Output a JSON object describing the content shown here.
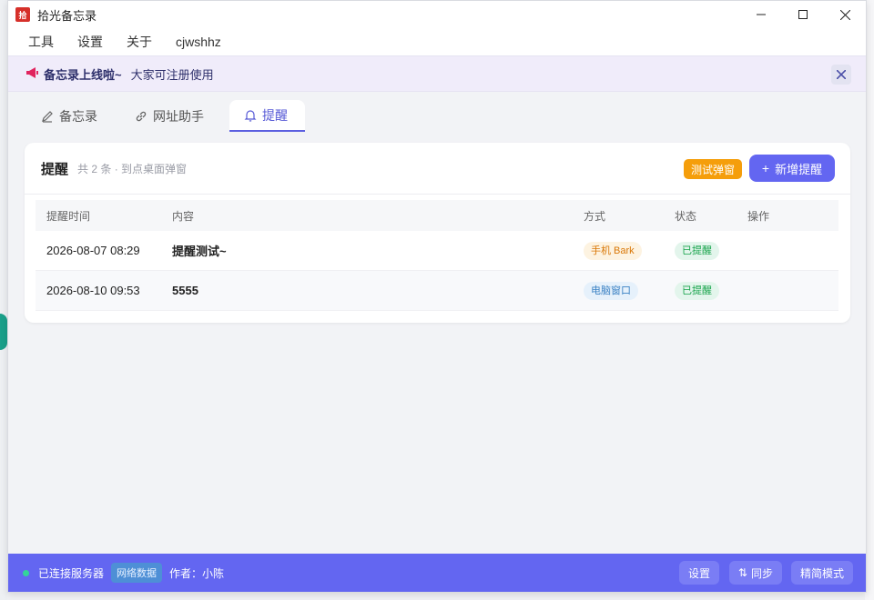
{
  "window": {
    "icon_text": "拾",
    "title": "拾光备忘录"
  },
  "menu": [
    "工具",
    "设置",
    "关于",
    "cjwshhz"
  ],
  "banner": {
    "title": "备忘录上线啦~",
    "text": "大家可注册使用"
  },
  "tabs": [
    {
      "label": "备忘录",
      "icon": "edit-icon",
      "active": false
    },
    {
      "label": "网址助手",
      "icon": "link-icon",
      "active": false
    },
    {
      "label": "提醒",
      "icon": "bell-icon",
      "active": true
    }
  ],
  "card": {
    "title": "提醒",
    "subtitle": "共 2 条 · 到点桌面弹窗",
    "test_button": "测试弹窗",
    "new_button_plus": "+",
    "new_button": "新增提醒"
  },
  "table": {
    "headers": {
      "time": "提醒时间",
      "content": "内容",
      "method": "方式",
      "status": "状态",
      "ops": "操作"
    },
    "rows": [
      {
        "time": "2026-08-07 08:29",
        "content": "提醒测试~",
        "method": "手机 Bark",
        "status": "已提醒"
      },
      {
        "time": "2026-08-10 09:53",
        "content": "5555",
        "method": "电脑窗口",
        "status": "已提醒"
      }
    ]
  },
  "footer": {
    "connection": "已连接服务器",
    "network_tag": "网络数据",
    "author": "作者：小陈",
    "settings_button": "设置",
    "sync_icon": "⇅",
    "sync_button": "同步",
    "simple_button": "精简模式"
  },
  "colors": {
    "accent": "#6366f1",
    "warning": "#f59e0b",
    "success": "#16a34a"
  }
}
